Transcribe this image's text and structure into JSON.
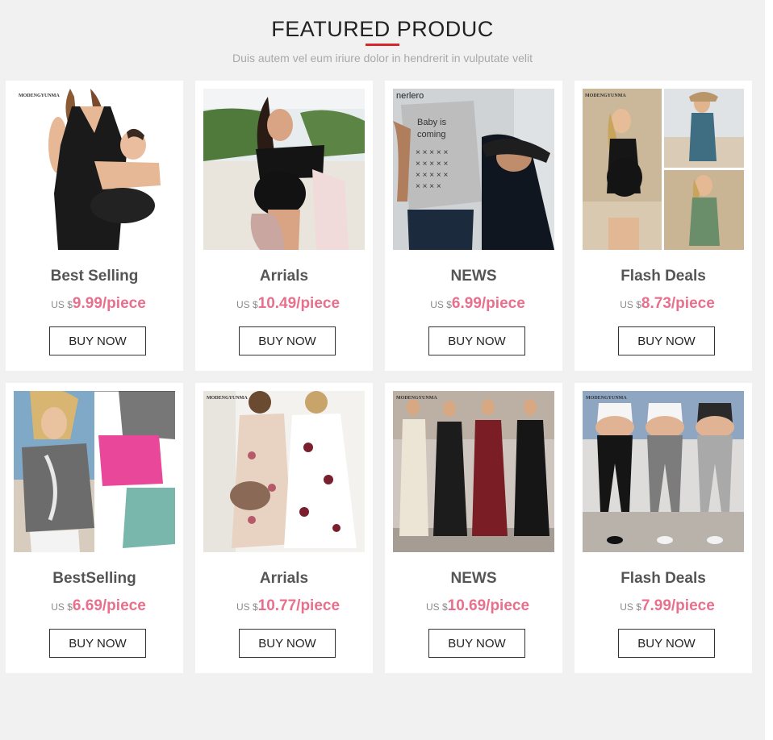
{
  "header": {
    "title": "FEATURED PRODUC",
    "subtitle": "Duis autem vel eum iriure dolor in hendrerit in vulputate velit"
  },
  "colors": {
    "accent": "#d9262d",
    "price": "#e8708c",
    "background": "#f1f1f1"
  },
  "products": [
    {
      "name": "Best Selling",
      "currency": "US $",
      "price": "9.99/piece",
      "button": "BUY NOW",
      "image": "nursing-dress-photo"
    },
    {
      "name": "Arrials",
      "currency": "US $",
      "price": "10.49/piece",
      "button": "BUY NOW",
      "image": "beach-swimsuit-photo"
    },
    {
      "name": "NEWS",
      "currency": "US $",
      "price": "6.99/piece",
      "button": "BUY NOW",
      "image": "baby-coming-tee-photo"
    },
    {
      "name": "Flash Deals",
      "currency": "US $",
      "price": "8.73/piece",
      "button": "BUY NOW",
      "image": "maternity-swimwear-collage"
    },
    {
      "name": "BestSelling",
      "currency": "US $",
      "price": "6.69/piece",
      "button": "BUY NOW",
      "image": "feather-print-tees-photo"
    },
    {
      "name": "Arrials",
      "currency": "US $",
      "price": "10.77/piece",
      "button": "BUY NOW",
      "image": "floral-maxi-dress-photo"
    },
    {
      "name": "NEWS",
      "currency": "US $",
      "price": "10.69/piece",
      "button": "BUY NOW",
      "image": "jumpsuits-photo"
    },
    {
      "name": "Flash Deals",
      "currency": "US $",
      "price": "7.99/piece",
      "button": "BUY NOW",
      "image": "maternity-leggings-photo"
    }
  ],
  "image_text": {
    "brand": "MODENGYUNMA",
    "tee_brand": "nerlero",
    "tee_line1": "Baby is",
    "tee_line2": "coming"
  }
}
